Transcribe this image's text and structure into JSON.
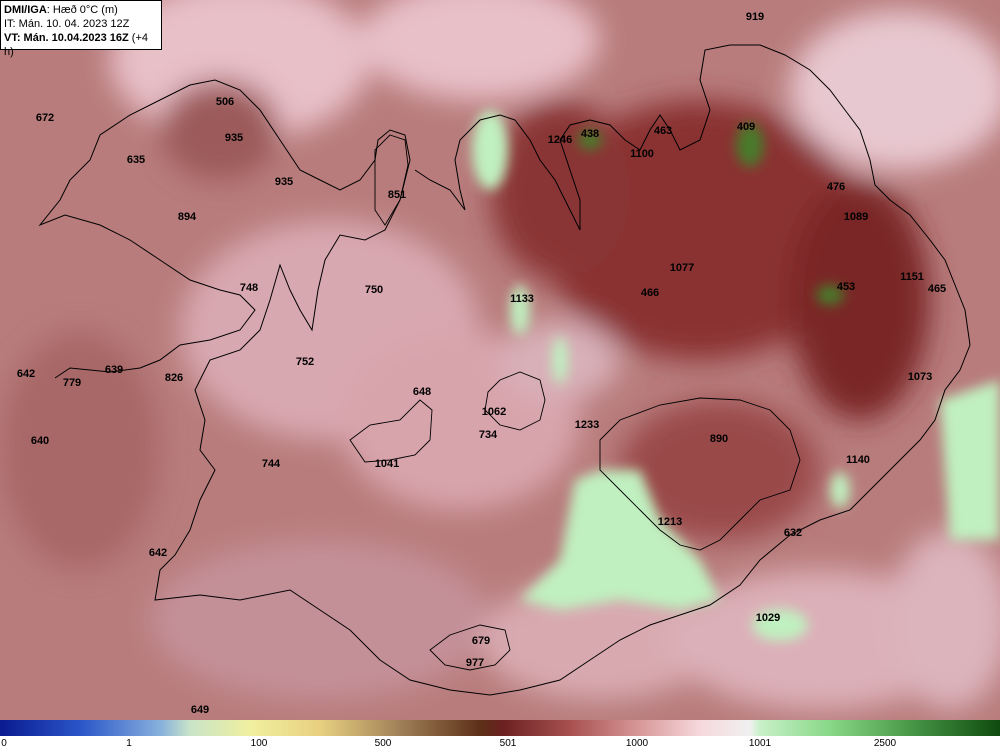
{
  "info": {
    "title_bold": "DMI/IGA",
    "title_rest": ": Hæð 0°C (m)",
    "it": "IT: Mán. 10. 04. 2023 12Z",
    "vt_bold": "VT: Mán. 10.04.2023 16Z",
    "vt_rest": " (+4 h)"
  },
  "colors": {
    "background": "#b87c7c",
    "dark": "#6e2222",
    "light_pink": "#e8b8c0",
    "green": "#c0f0c0",
    "dark_green": "#4a7a2a",
    "coastline": "#000000"
  },
  "labels": [
    "919",
    "672",
    "506",
    "935",
    "635",
    "935",
    "851",
    "894",
    "1246",
    "438",
    "1100",
    "463",
    "409",
    "476",
    "1089",
    "1077",
    "466",
    "453",
    "1151",
    "465",
    "748",
    "750",
    "1133",
    "642",
    "779",
    "639",
    "826",
    "752",
    "1073",
    "648",
    "1062",
    "734",
    "1233",
    "890",
    "640",
    "1041",
    "744",
    "1140",
    "1213",
    "632",
    "642",
    "1029",
    "679",
    "977",
    "649"
  ],
  "legend": {
    "ticks": [
      "0",
      "1",
      "100",
      "500",
      "501",
      "1000",
      "1001",
      "2500"
    ]
  }
}
